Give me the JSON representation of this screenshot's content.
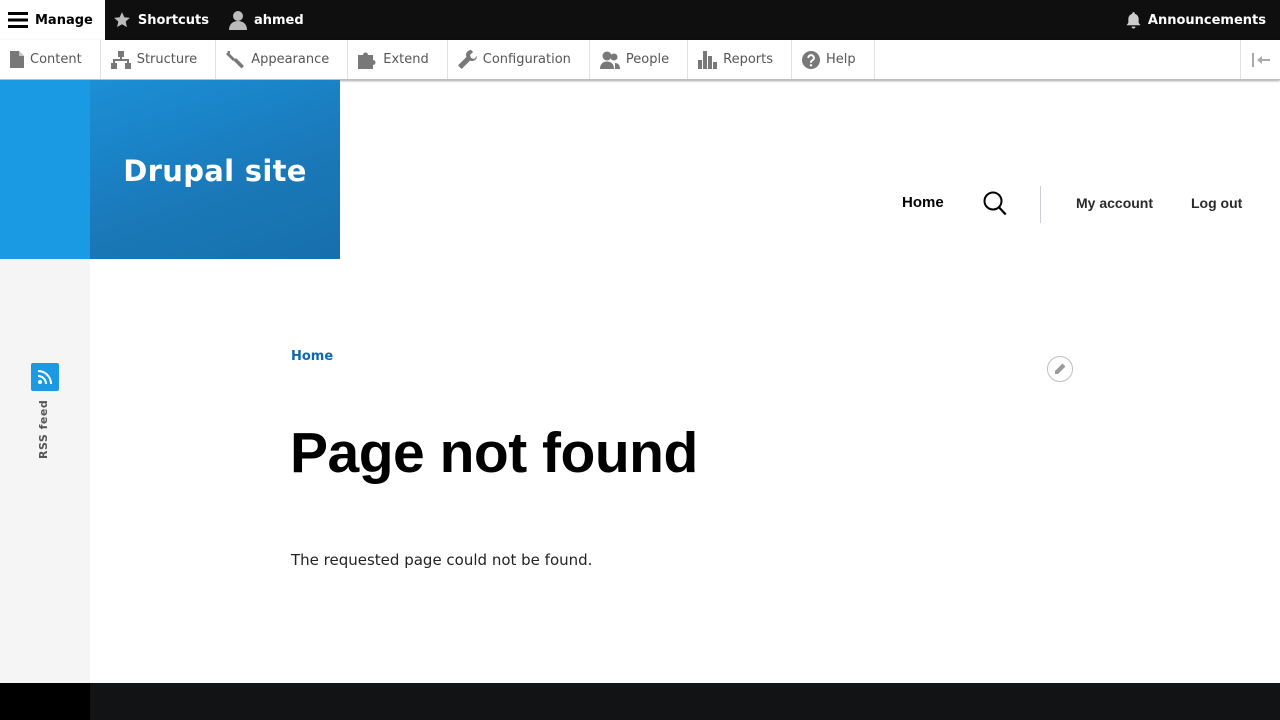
{
  "toolbar": {
    "manage_label": "Manage",
    "shortcuts_label": "Shortcuts",
    "user_label": "ahmed",
    "announcements_label": "Announcements"
  },
  "tray": {
    "items": [
      {
        "label": "Content",
        "icon": "file-icon"
      },
      {
        "label": "Structure",
        "icon": "structure-icon"
      },
      {
        "label": "Appearance",
        "icon": "paintbrush-icon"
      },
      {
        "label": "Extend",
        "icon": "puzzle-icon"
      },
      {
        "label": "Configuration",
        "icon": "wrench-icon"
      },
      {
        "label": "People",
        "icon": "people-icon"
      },
      {
        "label": "Reports",
        "icon": "bar-chart-icon"
      },
      {
        "label": "Help",
        "icon": "help-icon"
      }
    ]
  },
  "site": {
    "name": "Drupal site"
  },
  "nav": {
    "home": "Home",
    "my_account": "My account",
    "log_out": "Log out"
  },
  "social": {
    "rss_label": "RSS feed"
  },
  "content": {
    "breadcrumb": "Home",
    "title": "Page not found",
    "body": "The requested page could not be found."
  },
  "colors": {
    "brand_blue": "#1b9ae4",
    "link_blue": "#0b69b2",
    "toolbar_black": "#0f0f0f"
  }
}
